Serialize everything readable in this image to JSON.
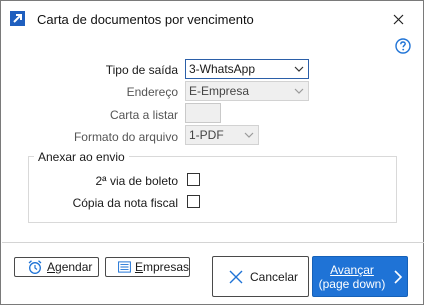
{
  "window": {
    "title": "Carta de documentos por vencimento"
  },
  "icons": {
    "app": "arrow-up-right-icon",
    "close": "close-icon",
    "help": "help-icon",
    "dropdown": "chevron-down-icon",
    "schedule": "alarm-clock-icon",
    "companies": "list-icon",
    "cancel": "x-icon",
    "next": "chevron-right-icon"
  },
  "colors": {
    "accent": "#1f73d6",
    "help": "#1f73d6"
  },
  "form": {
    "tipo_saida": {
      "label": "Tipo de saída",
      "value": "3-WhatsApp"
    },
    "endereco": {
      "label": "Endereço",
      "value": "E-Empresa"
    },
    "carta": {
      "label": "Carta a listar",
      "value": ""
    },
    "formato": {
      "label": "Formato do arquivo",
      "value": "1-PDF"
    }
  },
  "anexar": {
    "title": "Anexar ao envio",
    "segunda_via": {
      "label": "2ª via de boleto",
      "checked": false
    },
    "copia_nota": {
      "label": "Cópia da nota fiscal",
      "checked": false
    }
  },
  "buttons": {
    "agendar": {
      "underlined": "A",
      "rest": "gendar"
    },
    "empresas": {
      "underlined": "E",
      "rest": "mpresas"
    },
    "cancelar": "Cancelar",
    "avancar": {
      "underlined": "Avançar",
      "line2": "(page down)"
    }
  }
}
